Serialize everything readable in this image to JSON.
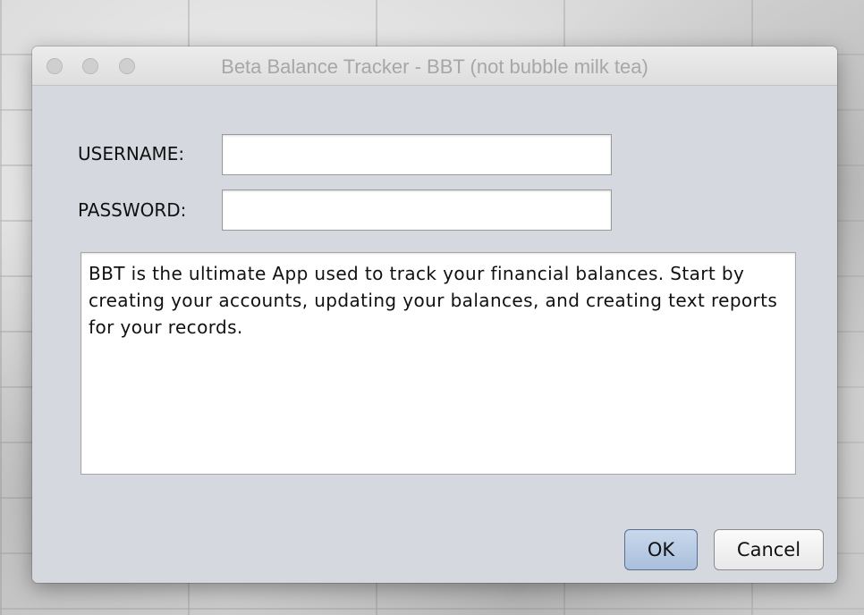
{
  "window": {
    "title": "Beta Balance Tracker - BBT (not bubble milk tea)"
  },
  "form": {
    "username_label": "USERNAME:",
    "username_value": "",
    "password_label": "PASSWORD:",
    "password_value": ""
  },
  "description": {
    "text": "BBT is the ultimate App used to track your financial balances. Start by creating your accounts, updating your balances, and creating text reports for your records."
  },
  "buttons": {
    "ok_label": "OK",
    "cancel_label": "Cancel"
  },
  "colors": {
    "window_bg": "#d5d8de",
    "title_text": "#a7a7a7",
    "ok_button_accent": "#a9bfdc"
  }
}
